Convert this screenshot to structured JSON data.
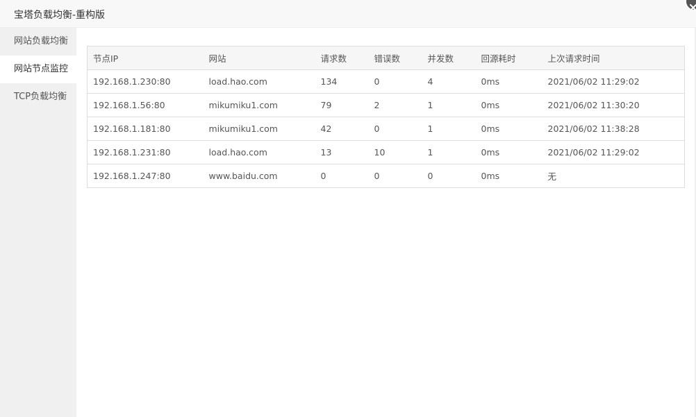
{
  "window": {
    "title": "宝塔负载均衡-重构版"
  },
  "sidebar": {
    "items": [
      {
        "label": "网站负载均衡",
        "active": false
      },
      {
        "label": "网站节点监控",
        "active": true
      },
      {
        "label": "TCP负载均衡",
        "active": false
      }
    ]
  },
  "table": {
    "headers": [
      "节点IP",
      "网站",
      "请求数",
      "错误数",
      "并发数",
      "回源耗时",
      "上次请求时间"
    ],
    "rows": [
      [
        "192.168.1.230:80",
        "load.hao.com",
        "134",
        "0",
        "4",
        "0ms",
        "2021/06/02 11:29:02"
      ],
      [
        "192.168.1.56:80",
        "mikumiku1.com",
        "79",
        "2",
        "1",
        "0ms",
        "2021/06/02 11:30:20"
      ],
      [
        "192.168.1.181:80",
        "mikumiku1.com",
        "42",
        "0",
        "1",
        "0ms",
        "2021/06/02 11:38:28"
      ],
      [
        "192.168.1.231:80",
        "load.hao.com",
        "13",
        "10",
        "1",
        "0ms",
        "2021/06/02 11:29:02"
      ],
      [
        "192.168.1.247:80",
        "www.baidu.com",
        "0",
        "0",
        "0",
        "0ms",
        "无"
      ]
    ]
  },
  "icons": {
    "close": "close-icon"
  },
  "colors": {
    "sidebar_bg": "#f0f0f0",
    "header_bg": "#f6f6f6",
    "border": "#dddddd",
    "close_button": "#555555"
  }
}
